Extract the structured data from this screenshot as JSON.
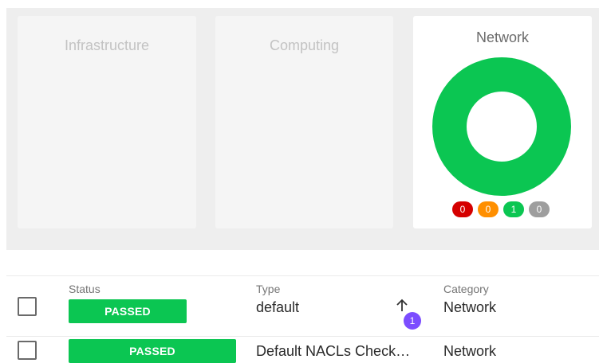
{
  "dashboard": {
    "cards": [
      {
        "title": "Infrastructure"
      },
      {
        "title": "Computing"
      },
      {
        "title": "Network"
      }
    ],
    "network_summary": {
      "failed": "0",
      "warning": "0",
      "passed": "1",
      "not_applicable": "0"
    }
  },
  "table": {
    "columns": {
      "status": "Status",
      "type": "Type",
      "category": "Category"
    },
    "rows": [
      {
        "status": "PASSED",
        "type": "default",
        "category": "Network",
        "count": "1"
      },
      {
        "status": "PASSED",
        "type": "Default NACLs Check…",
        "category": "Network"
      }
    ]
  },
  "colors": {
    "passed": "#0bc652",
    "failed": "#d50000",
    "warning": "#ff8f00",
    "na": "#9e9e9e",
    "count_badge": "#7c4dff"
  },
  "icons": {
    "sort": "arrow-up-icon"
  }
}
